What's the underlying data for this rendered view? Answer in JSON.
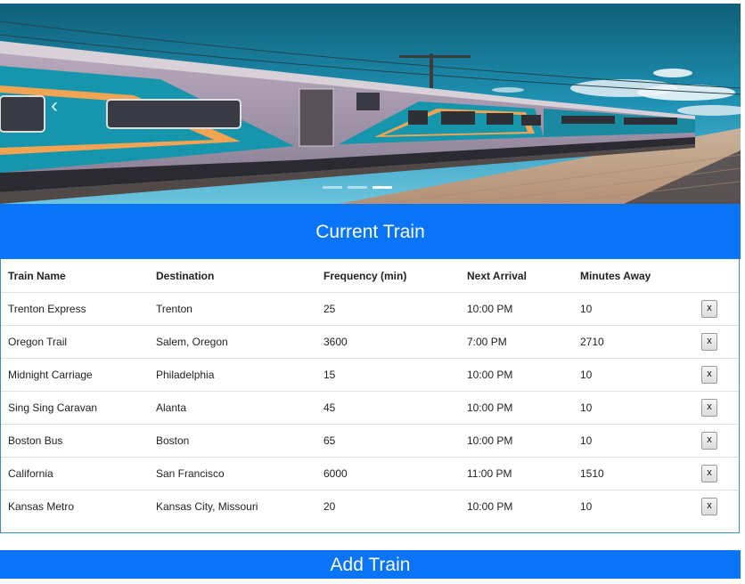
{
  "hero": {
    "prev_glyph": "‹",
    "slide_count": 3,
    "active_slide": 2
  },
  "current_train": {
    "title": "Current Train",
    "columns": [
      "Train Name",
      "Destination",
      "Frequency (min)",
      "Next Arrival",
      "Minutes Away"
    ],
    "delete_label": "x",
    "rows": [
      {
        "name": "Trenton Express",
        "destination": "Trenton",
        "frequency": "25",
        "next_arrival": "10:00 PM",
        "minutes_away": "10"
      },
      {
        "name": "Oregon Trail",
        "destination": "Salem, Oregon",
        "frequency": "3600",
        "next_arrival": "7:00 PM",
        "minutes_away": "2710"
      },
      {
        "name": "Midnight Carriage",
        "destination": "Philadelphia",
        "frequency": "15",
        "next_arrival": "10:00 PM",
        "minutes_away": "10"
      },
      {
        "name": "Sing Sing Caravan",
        "destination": "Alanta",
        "frequency": "45",
        "next_arrival": "10:00 PM",
        "minutes_away": "10"
      },
      {
        "name": "Boston Bus",
        "destination": "Boston",
        "frequency": "65",
        "next_arrival": "10:00 PM",
        "minutes_away": "10"
      },
      {
        "name": "California",
        "destination": "San Francisco",
        "frequency": "6000",
        "next_arrival": "11:00 PM",
        "minutes_away": "1510"
      },
      {
        "name": "Kansas Metro",
        "destination": "Kansas City, Missouri",
        "frequency": "20",
        "next_arrival": "10:00 PM",
        "minutes_away": "10"
      }
    ]
  },
  "add_train": {
    "title": "Add Train"
  },
  "colors": {
    "header_blue": "#0a74f7",
    "panel_border": "#3b8fc7"
  }
}
